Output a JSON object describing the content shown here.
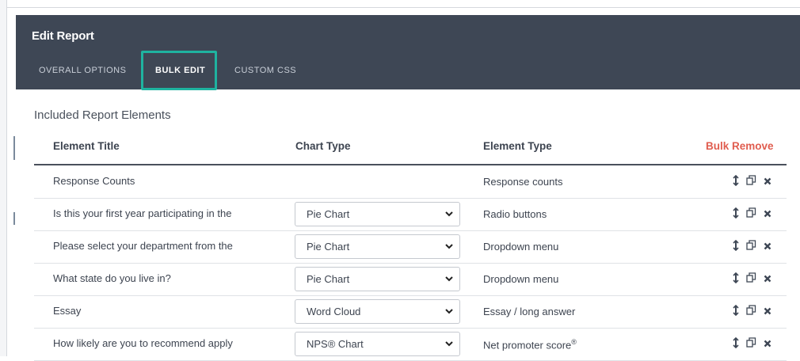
{
  "header": {
    "title": "Edit Report",
    "tabs": [
      {
        "label": "OVERALL OPTIONS",
        "active": false
      },
      {
        "label": "BULK EDIT",
        "active": true
      },
      {
        "label": "CUSTOM CSS",
        "active": false
      }
    ]
  },
  "section": {
    "title": "Included Report Elements"
  },
  "table": {
    "columns": {
      "element_title": "Element Title",
      "chart_type": "Chart Type",
      "element_type": "Element Type",
      "bulk_remove": "Bulk Remove"
    },
    "rows": [
      {
        "title": "Response Counts",
        "chart_type": null,
        "element_type": "Response counts"
      },
      {
        "title": "Is this your first year participating in the",
        "chart_type": "Pie Chart",
        "element_type": "Radio buttons"
      },
      {
        "title": "Please select your department from the",
        "chart_type": "Pie Chart",
        "element_type": "Dropdown menu"
      },
      {
        "title": "What state do you live in?",
        "chart_type": "Pie Chart",
        "element_type": "Dropdown menu"
      },
      {
        "title": "Essay",
        "chart_type": "Word Cloud",
        "element_type": "Essay / long answer"
      },
      {
        "title": "How likely are you to recommend apply",
        "chart_type": "NPS® Chart",
        "element_type": "Net promoter score",
        "element_type_sup": "®"
      }
    ],
    "row_icons": [
      "move-icon",
      "copy-icon",
      "remove-icon"
    ]
  },
  "colors": {
    "header_bg": "#3e4755",
    "tab_highlight": "#1fb3a0",
    "bulk_remove": "#e05d4f",
    "icon_dark": "#3e4755"
  }
}
